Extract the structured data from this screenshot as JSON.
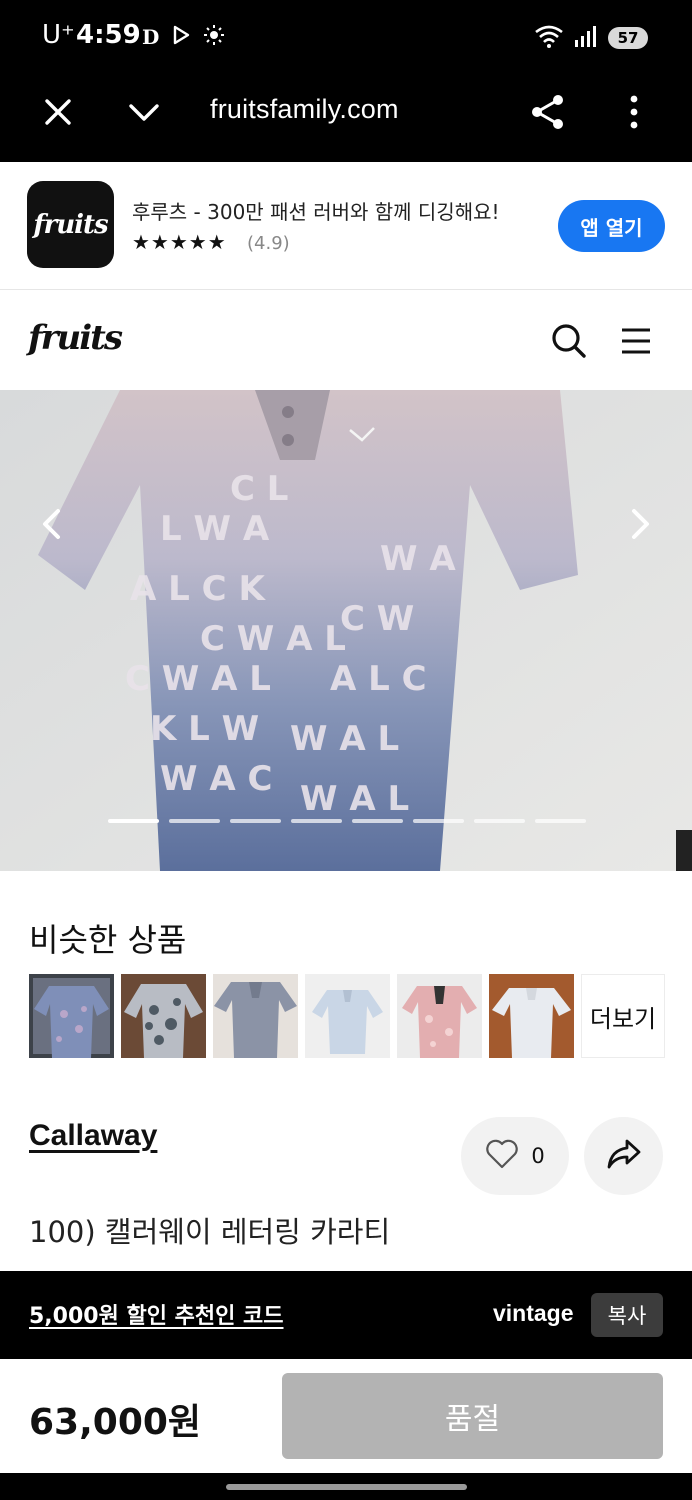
{
  "status_bar": {
    "carrier": "U⁺",
    "time": "4:59",
    "battery": "57",
    "icons": [
      "d-notification-icon",
      "play-icon",
      "brightness-icon",
      "wifi-icon",
      "signal-icon",
      "battery-icon"
    ]
  },
  "browser": {
    "url": "fruitsfamily.com",
    "icons": [
      "close-icon",
      "chevron-down-icon",
      "share-icon",
      "more-vert-icon"
    ]
  },
  "app_banner": {
    "logo_text": "fruits",
    "title": "후루츠 - 300만 패션 러버와 함께 디깅해요!",
    "stars": "★★★★★",
    "rating": "(4.9)",
    "open_label": "앱 열기",
    "accent": "#1877f2"
  },
  "header": {
    "logo_text": "fruits",
    "icons": [
      "search-icon",
      "menu-icon"
    ]
  },
  "gallery": {
    "total_images": 8,
    "current_index": 1,
    "icons": [
      "chevron-left-icon",
      "chevron-right-icon"
    ]
  },
  "similar": {
    "title": "비슷한 상품",
    "more_label": "더보기",
    "thumbnails": [
      {
        "name": "thumb-1",
        "color": "#7f8fb8"
      },
      {
        "name": "thumb-2",
        "color": "#b8bcc4"
      },
      {
        "name": "thumb-3",
        "color": "#8b93a6"
      },
      {
        "name": "thumb-4",
        "color": "#c9d6e6"
      },
      {
        "name": "thumb-5",
        "color": "#e3aeb0"
      },
      {
        "name": "thumb-6",
        "color": "#e8ebf0"
      }
    ]
  },
  "product": {
    "brand": "Callaway",
    "name": "100) 캘러웨이 레터링 카라티",
    "likes": "0",
    "price": "63,000원",
    "status_button": "품절"
  },
  "promo": {
    "code_text": "5,000원 할인 추천인 코드",
    "code_value": "vintage",
    "copy_label": "복사"
  }
}
